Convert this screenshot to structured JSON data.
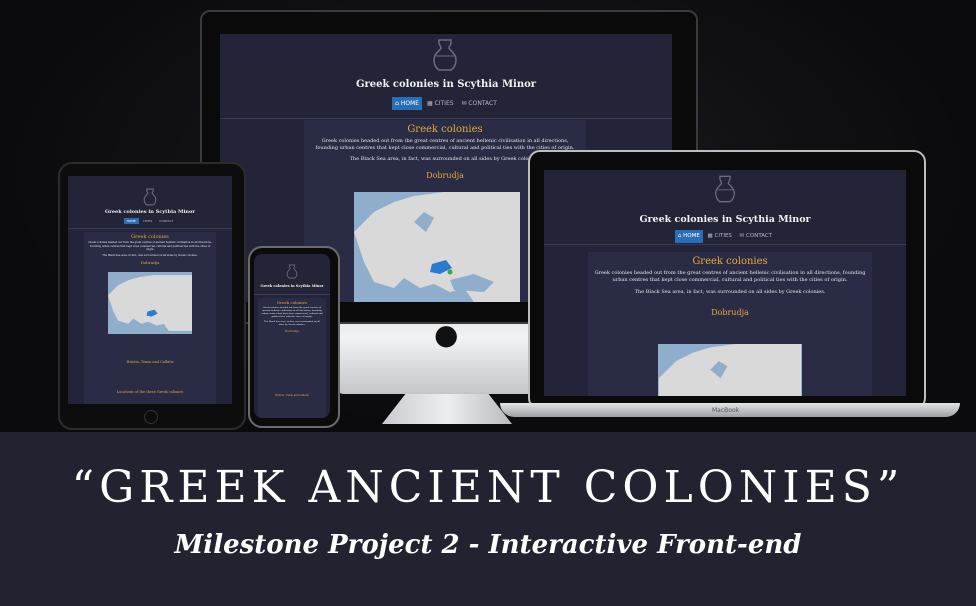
{
  "site": {
    "title": "Greek colonies in Scythia Minor",
    "nav": [
      {
        "label": "HOME",
        "icon": "home-icon",
        "active": true
      },
      {
        "label": "CITIES",
        "icon": "columns-icon",
        "active": false
      },
      {
        "label": "CONTACT",
        "icon": "envelope-icon",
        "active": false
      }
    ],
    "section_heading": "Greek colonies",
    "paragraph1": "Greek colonies headed out from the great centres of ancient hellenic civilisation in all directions, founding urban centres that kept close commercial, cultural and political ties with the cities of origin.",
    "paragraph2": "The Black Sea area, in fact, was surrounded on all sides by Greek colonies.",
    "map_heading": "Dobrudja",
    "extra_heading": "Histria, Tomis and Callatis",
    "footer_heading": "Locations of the three Greek colonies"
  },
  "devices": {
    "laptop_label": "MacBook"
  },
  "banner": {
    "headline": "“GREEK ANCIENT COLONIES”",
    "subtitle": "Milestone Project 2 - Interactive Front-end"
  },
  "colors": {
    "background": "#222231",
    "accent_heading": "#e8a93a",
    "nav_active": "#2a6fb6",
    "map_sea": "#8faecb",
    "map_land": "#d9d9d9",
    "map_highlight": "#2a7ad1"
  }
}
